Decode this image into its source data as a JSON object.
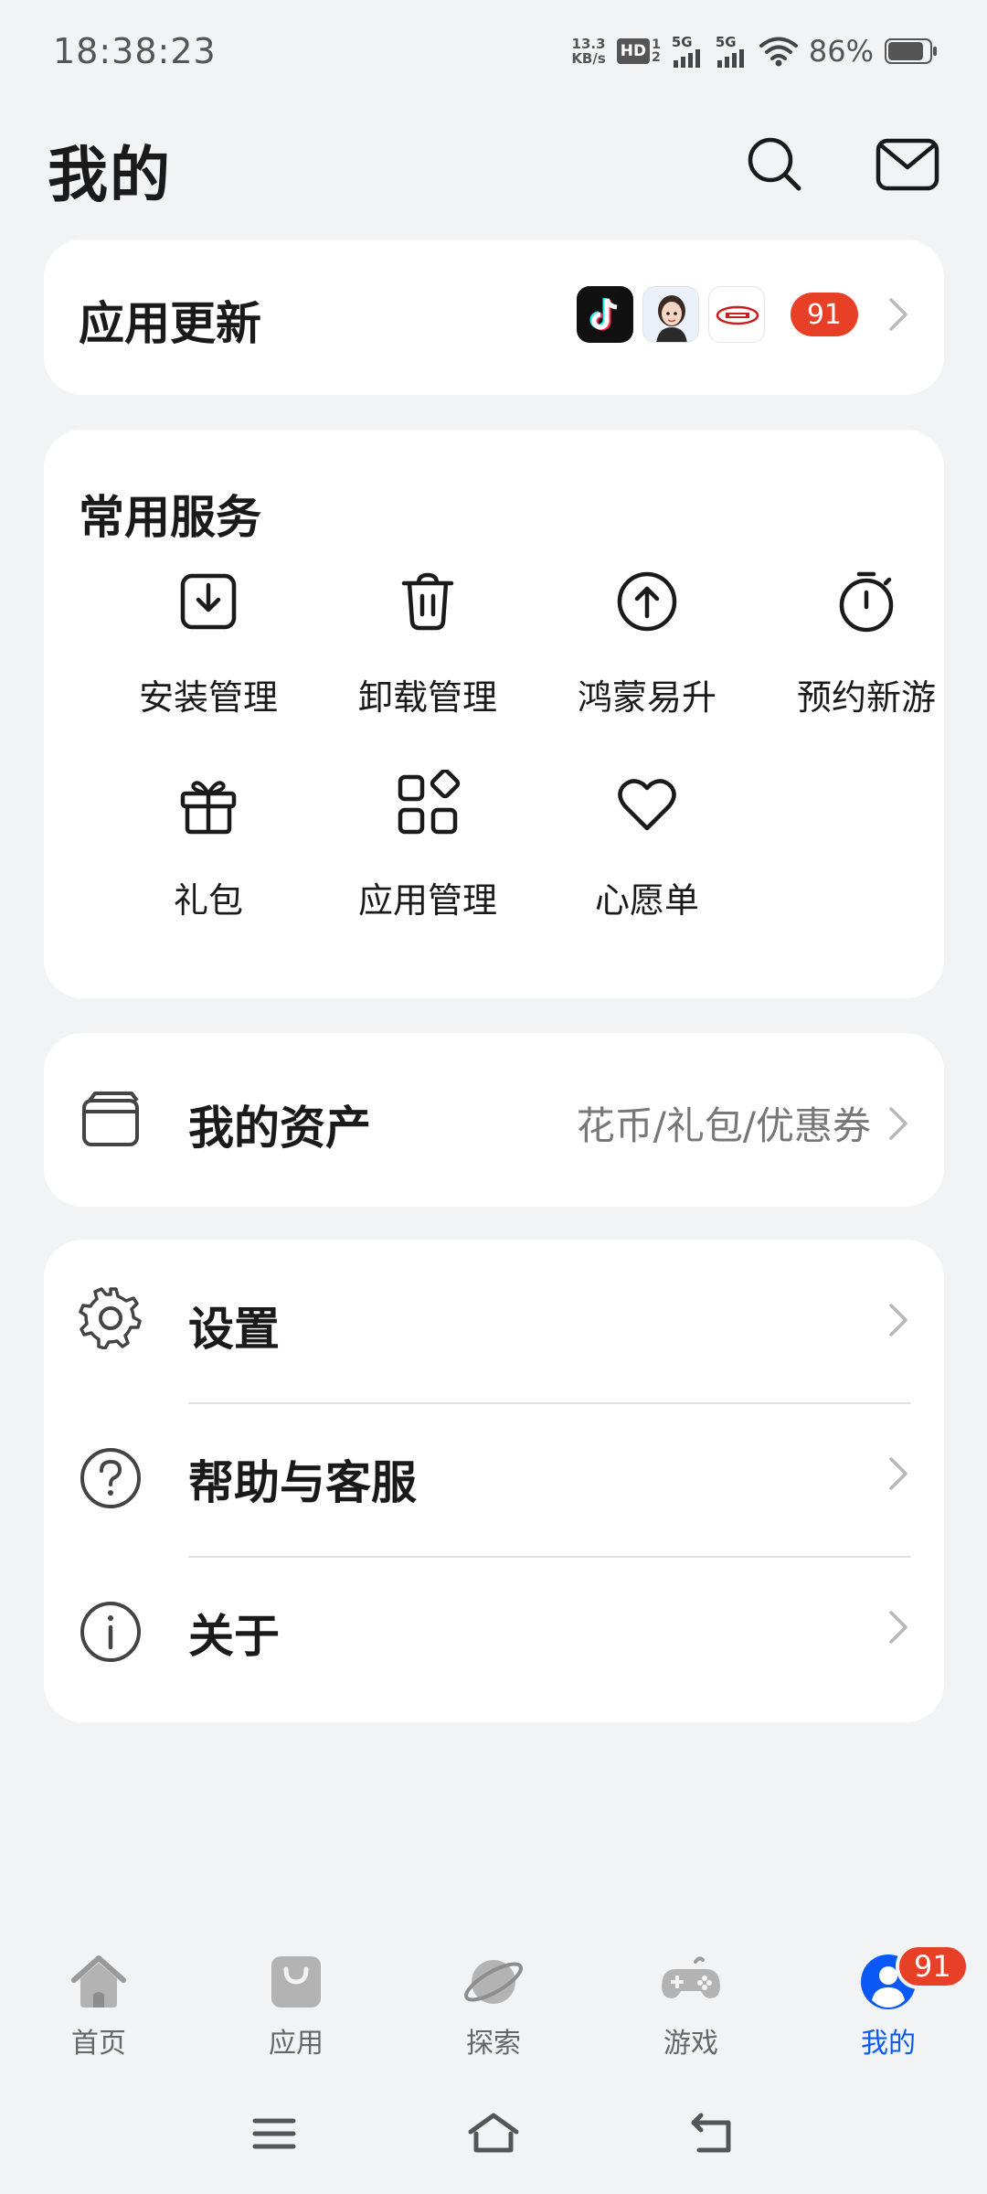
{
  "status_bar": {
    "time": "18:38:23",
    "net_speed_value": "13.3",
    "net_speed_unit": "KB/s",
    "hd_label": "HD",
    "hd_sub_top": "1",
    "hd_sub_bottom": "2",
    "sim1_label": "5G",
    "sim2_label": "5G",
    "battery_percent": "86%"
  },
  "header": {
    "title": "我的"
  },
  "app_update": {
    "title": "应用更新",
    "count": "91",
    "apps": [
      "tiktok-app-icon",
      "avatar-app-icon",
      "brand-app-icon"
    ]
  },
  "services": {
    "title": "常用服务",
    "items": [
      {
        "label": "安装管理",
        "icon": "install-icon"
      },
      {
        "label": "卸载管理",
        "icon": "trash-icon"
      },
      {
        "label": "鸿蒙易升",
        "icon": "upgrade-icon"
      },
      {
        "label": "预约新游",
        "icon": "stopwatch-icon"
      },
      {
        "label": "礼包",
        "icon": "gift-icon"
      },
      {
        "label": "应用管理",
        "icon": "apps-grid-icon"
      },
      {
        "label": "心愿单",
        "icon": "heart-icon"
      }
    ]
  },
  "assets": {
    "label": "我的资产",
    "sub": "花币/礼包/优惠券"
  },
  "settings_list": {
    "items": [
      {
        "label": "设置",
        "icon": "gear-icon"
      },
      {
        "label": "帮助与客服",
        "icon": "help-icon"
      },
      {
        "label": "关于",
        "icon": "info-icon"
      }
    ]
  },
  "bottom_nav": {
    "items": [
      {
        "label": "首页",
        "icon": "home-icon"
      },
      {
        "label": "应用",
        "icon": "bag-icon"
      },
      {
        "label": "探索",
        "icon": "planet-icon"
      },
      {
        "label": "游戏",
        "icon": "gamepad-icon"
      },
      {
        "label": "我的",
        "icon": "profile-icon"
      }
    ],
    "active_index": 4,
    "badge": "91"
  },
  "colors": {
    "background": "#f1f3f5",
    "card": "#ffffff",
    "badge_red": "#e84026",
    "active_blue": "#0a59f7"
  }
}
